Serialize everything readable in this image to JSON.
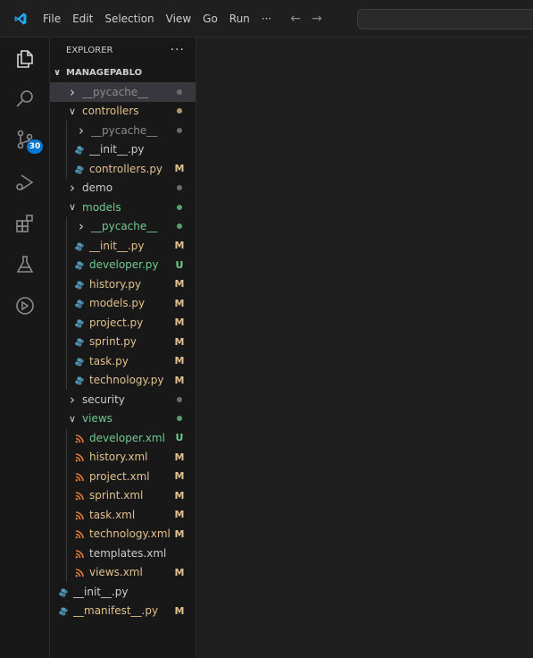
{
  "colors": {
    "accent": "#0078d4",
    "modified": "#e2c08d",
    "untracked": "#73c991",
    "default_text": "#cccccc",
    "ignored": "#8c8c8c",
    "python_icon": "#519aba",
    "xml_icon": "#e37933"
  },
  "titlebar": {
    "menu": [
      "File",
      "Edit",
      "Selection",
      "View",
      "Go",
      "Run",
      "···"
    ],
    "nav_back_icon": "arrow-left-icon",
    "nav_forward_icon": "arrow-right-icon"
  },
  "activitybar": {
    "items": [
      {
        "name": "explorer-icon"
      },
      {
        "name": "search-icon"
      },
      {
        "name": "source-control-icon",
        "badge": "30"
      },
      {
        "name": "run-debug-icon"
      },
      {
        "name": "extensions-icon"
      },
      {
        "name": "testing-icon"
      },
      {
        "name": "remote-explorer-icon"
      }
    ]
  },
  "sidebar": {
    "title": "EXPLORER",
    "more": "···",
    "root": "MANAGEPABLO",
    "tree": [
      {
        "label": "__pycache__",
        "depth": 1,
        "type": "folder",
        "expanded": false,
        "color": "ignored",
        "decoration": "dot-gray",
        "selected": true
      },
      {
        "label": "controllers",
        "depth": 1,
        "type": "folder",
        "expanded": true,
        "color": "modified",
        "decoration": "dot-modified"
      },
      {
        "label": "__pycache__",
        "depth": 2,
        "type": "folder",
        "expanded": false,
        "color": "ignored",
        "decoration": "dot-gray"
      },
      {
        "label": "__init__.py",
        "depth": 2,
        "type": "py",
        "color": "default",
        "decoration": ""
      },
      {
        "label": "controllers.py",
        "depth": 2,
        "type": "py",
        "color": "modified",
        "decoration": "M"
      },
      {
        "label": "demo",
        "depth": 1,
        "type": "folder",
        "expanded": false,
        "color": "default",
        "decoration": "dot-gray"
      },
      {
        "label": "models",
        "depth": 1,
        "type": "folder",
        "expanded": true,
        "color": "untracked",
        "decoration": "dot-untracked"
      },
      {
        "label": "__pycache__",
        "depth": 2,
        "type": "folder",
        "expanded": false,
        "color": "untracked",
        "decoration": "dot-untracked"
      },
      {
        "label": "__init__.py",
        "depth": 2,
        "type": "py",
        "color": "modified",
        "decoration": "M"
      },
      {
        "label": "developer.py",
        "depth": 2,
        "type": "py",
        "color": "untracked",
        "decoration": "U"
      },
      {
        "label": "history.py",
        "depth": 2,
        "type": "py",
        "color": "modified",
        "decoration": "M"
      },
      {
        "label": "models.py",
        "depth": 2,
        "type": "py",
        "color": "modified",
        "decoration": "M"
      },
      {
        "label": "project.py",
        "depth": 2,
        "type": "py",
        "color": "modified",
        "decoration": "M"
      },
      {
        "label": "sprint.py",
        "depth": 2,
        "type": "py",
        "color": "modified",
        "decoration": "M"
      },
      {
        "label": "task.py",
        "depth": 2,
        "type": "py",
        "color": "modified",
        "decoration": "M"
      },
      {
        "label": "technology.py",
        "depth": 2,
        "type": "py",
        "color": "modified",
        "decoration": "M"
      },
      {
        "label": "security",
        "depth": 1,
        "type": "folder",
        "expanded": false,
        "color": "default",
        "decoration": "dot-gray"
      },
      {
        "label": "views",
        "depth": 1,
        "type": "folder",
        "expanded": true,
        "color": "untracked",
        "decoration": "dot-untracked"
      },
      {
        "label": "developer.xml",
        "depth": 2,
        "type": "xml",
        "color": "untracked",
        "decoration": "U"
      },
      {
        "label": "history.xml",
        "depth": 2,
        "type": "xml",
        "color": "modified",
        "decoration": "M"
      },
      {
        "label": "project.xml",
        "depth": 2,
        "type": "xml",
        "color": "modified",
        "decoration": "M"
      },
      {
        "label": "sprint.xml",
        "depth": 2,
        "type": "xml",
        "color": "modified",
        "decoration": "M"
      },
      {
        "label": "task.xml",
        "depth": 2,
        "type": "xml",
        "color": "modified",
        "decoration": "M"
      },
      {
        "label": "technology.xml",
        "depth": 2,
        "type": "xml",
        "color": "modified",
        "decoration": "M"
      },
      {
        "label": "templates.xml",
        "depth": 2,
        "type": "xml",
        "color": "default",
        "decoration": ""
      },
      {
        "label": "views.xml",
        "depth": 2,
        "type": "xml",
        "color": "modified",
        "decoration": "M"
      },
      {
        "label": "__init__.py",
        "depth": 0,
        "type": "py",
        "color": "default",
        "decoration": ""
      },
      {
        "label": "__manifest__.py",
        "depth": 0,
        "type": "py",
        "color": "modified",
        "decoration": "M"
      }
    ]
  }
}
